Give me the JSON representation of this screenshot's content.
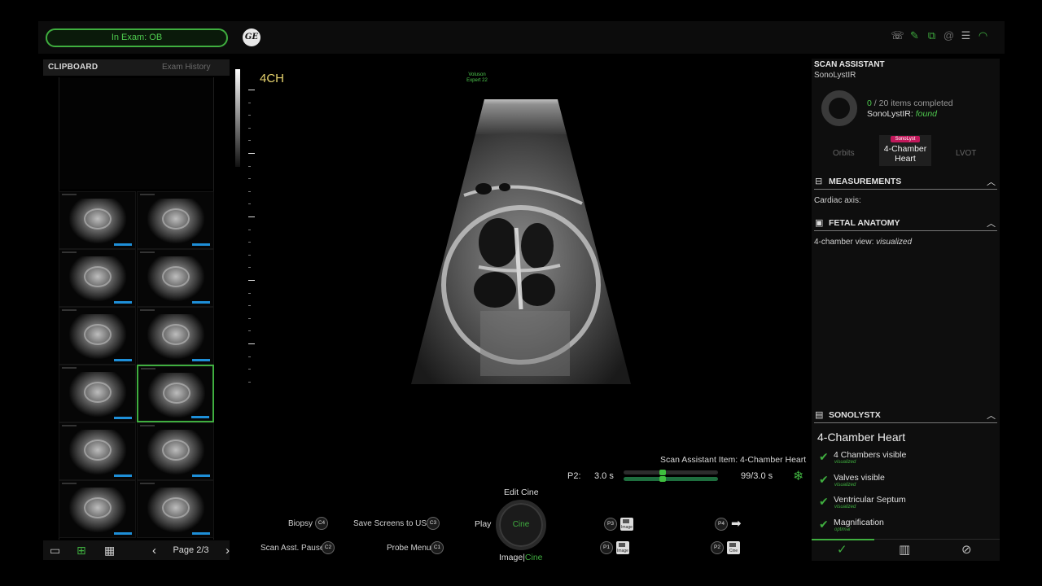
{
  "header": {
    "exam_status": "In Exam: OB",
    "logo_text": "GE",
    "status_icons": [
      "phone-icon",
      "pen-icon",
      "network-icon",
      "at-icon",
      "report-icon",
      "wifi-icon"
    ]
  },
  "clipboard": {
    "title": "CLIPBOARD",
    "history_tab": "Exam History",
    "page_label": "Page 2/3",
    "prev_glyph": "‹",
    "next_glyph": "›",
    "thumbnail_count": 12,
    "selected_thumbnail": 7
  },
  "scan": {
    "view_label": "4CH",
    "probe_line1": "Voluson",
    "probe_line2": "Expert 22"
  },
  "cine": {
    "scan_assistant_item": "Scan Assistant Item: 4-Chamber Heart",
    "p2_label": "P2:",
    "p2_value": "3.0 s",
    "frame_value": "99/3.0 s"
  },
  "controls": {
    "biopsy": "Biopsy",
    "biopsy_key": "C4",
    "save_usb": "Save Screens to USB",
    "save_usb_key": "C3",
    "scan_pause": "Scan Asst. Pause",
    "scan_pause_key": "C2",
    "probe_menu": "Probe Menu",
    "probe_menu_key": "C1",
    "edit_cine": "Edit Cine",
    "play": "Play",
    "knob": "Cine",
    "image_part": "Image",
    "sep": "|",
    "cine_part": "Cine",
    "p3_key": "P3",
    "p3_glyph": "Image",
    "p4_key": "P4",
    "p1_key": "P1",
    "p1_glyph": "Image",
    "p2_key": "P2",
    "p2_glyph": "Cine"
  },
  "scan_assistant": {
    "title": "SCAN ASSISTANT",
    "subtitle": "SonoLystIR",
    "completed": "0",
    "total_text": "/ 20 items completed",
    "found_label": "SonoLystIR:",
    "found_value": "found",
    "carousel_prev": "Orbits",
    "carousel_current": "4-Chamber Heart",
    "carousel_next": "LVOT",
    "carousel_badge": "SonoLyst"
  },
  "measurements": {
    "title": "MEASUREMENTS",
    "line": "Cardiac axis:"
  },
  "fetal_anatomy": {
    "title": "FETAL ANATOMY",
    "label": "4-chamber view:",
    "value": "visualized"
  },
  "sonolystx": {
    "title": "SONOLYSTX",
    "heading": "4-Chamber Heart",
    "items": [
      {
        "label": "4 Chambers visible",
        "status": "visualized"
      },
      {
        "label": "Valves visible",
        "status": "visualized"
      },
      {
        "label": "Ventricular Septum",
        "status": "visualized"
      },
      {
        "label": "Magnification",
        "status": "optimal"
      }
    ]
  },
  "colors": {
    "accent_green": "#3fae3f",
    "thumb_tag": "#1e8fd8",
    "view_label": "#e7d36e",
    "badge": "#c2185b"
  }
}
